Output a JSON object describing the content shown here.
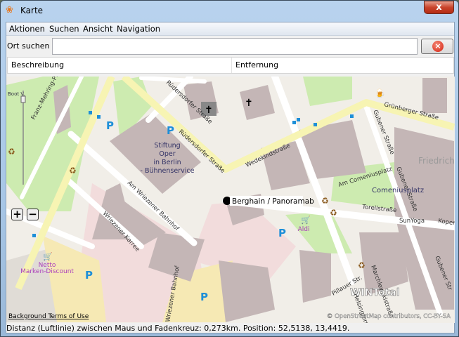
{
  "window": {
    "title": "Karte",
    "close_label": "x"
  },
  "menu": [
    "Aktionen",
    "Suchen",
    "Ansicht",
    "Navigation"
  ],
  "search": {
    "label": "Ort suchen",
    "value": "",
    "placeholder": ""
  },
  "table": {
    "columns": [
      "Beschreibung",
      "Entfernung"
    ]
  },
  "map": {
    "zoom_slider_label": "Boot V.",
    "labels": {
      "franz": "Franz-Mehring-Pl.",
      "ruders1": "Rüdersdorfer Straße",
      "ruders2": "Rüdersdorfer Straße",
      "oper1": "Stiftung",
      "oper2": "Oper",
      "oper3": "in Berlin",
      "oper4": "- Bühnenservice",
      "wedekind": "Wedekindstraße",
      "gruenberger": "Grünberger Straße",
      "gubener1": "Gubener Straße",
      "gubener2": "Gubener Straße",
      "gubener3": "Gubener Str",
      "friedrich": "Friedrich",
      "amcomenius": "Am Comeniusplatz",
      "comenius": "Comeniusplatz",
      "torell": "Torellstraße",
      "sunyoga": "SunYoga",
      "kopen": "Kopen",
      "awb": "Am Wriezener Bahnhof",
      "wkarree": "Wriezener Karree",
      "wbahnhof2": "Wriezener Bahnhof",
      "aldi": "Aldi",
      "netto1": "Netto",
      "netto2": "Marken-Discount",
      "pillauer": "Pillauer Str.",
      "marchlewski": "Marchlewskistraße",
      "heli": "Helsingforser"
    },
    "tooltip": "Berghain / Panoramab",
    "attribution_left": "Background Terms of Use",
    "attribution_right": "© OpenStreetMap contributors, CC-BY-SA",
    "watermark": "WINTotal"
  },
  "status": "Distanz (Luftlinie) zwischen Maus und Fadenkreuz: 0,273km. Position: 52,5138, 13,4419."
}
